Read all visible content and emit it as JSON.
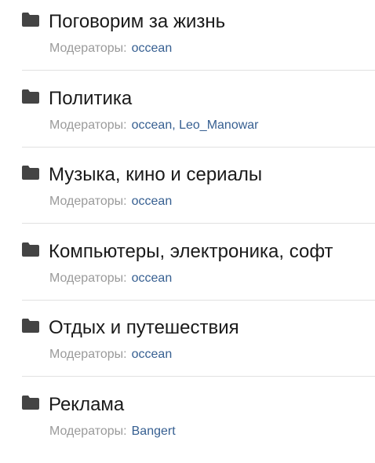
{
  "forums": [
    {
      "title": "Поговорим за жизнь",
      "moderators_label": "Модераторы:",
      "moderators": [
        "occean"
      ]
    },
    {
      "title": "Политика",
      "moderators_label": "Модераторы:",
      "moderators": [
        "occean",
        "Leo_Manowar"
      ]
    },
    {
      "title": "Музыка, кино и сериалы",
      "moderators_label": "Модераторы:",
      "moderators": [
        "occean"
      ]
    },
    {
      "title": "Компьютеры, электроника, софт",
      "moderators_label": "Модераторы:",
      "moderators": [
        "occean"
      ]
    },
    {
      "title": "Отдых и путешествия",
      "moderators_label": "Модераторы:",
      "moderators": [
        "occean"
      ]
    },
    {
      "title": "Реклама",
      "moderators_label": "Модераторы:",
      "moderators": [
        "Bangert"
      ]
    }
  ],
  "colors": {
    "title": "#1a1a1a",
    "label": "#9a9a9a",
    "link": "#365f91",
    "icon": "#444444",
    "divider": "#e1e1e1"
  },
  "icon": "folder-icon"
}
